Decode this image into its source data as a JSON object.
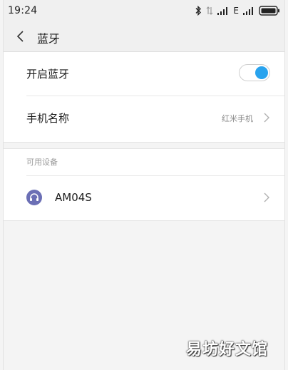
{
  "status_bar": {
    "time": "19:24",
    "network_type": "E",
    "icons": [
      "bluetooth-icon",
      "data-off-icon",
      "signal-icon",
      "signal-icon",
      "battery-icon"
    ]
  },
  "header": {
    "back_icon": "chevron-left-icon",
    "title": "蓝牙"
  },
  "settings": {
    "bluetooth_toggle": {
      "label": "开启蓝牙",
      "state": "on"
    },
    "device_name": {
      "label": "手机名称",
      "value": "红米手机"
    }
  },
  "available_devices": {
    "section_label": "可用设备",
    "items": [
      {
        "name": "AM04S",
        "icon": "headset-icon"
      }
    ]
  },
  "watermark": "易坊好文馆",
  "colors": {
    "accent": "#29a3ee",
    "device_icon": "#6b6fb5",
    "background": "#f4f4f4"
  }
}
